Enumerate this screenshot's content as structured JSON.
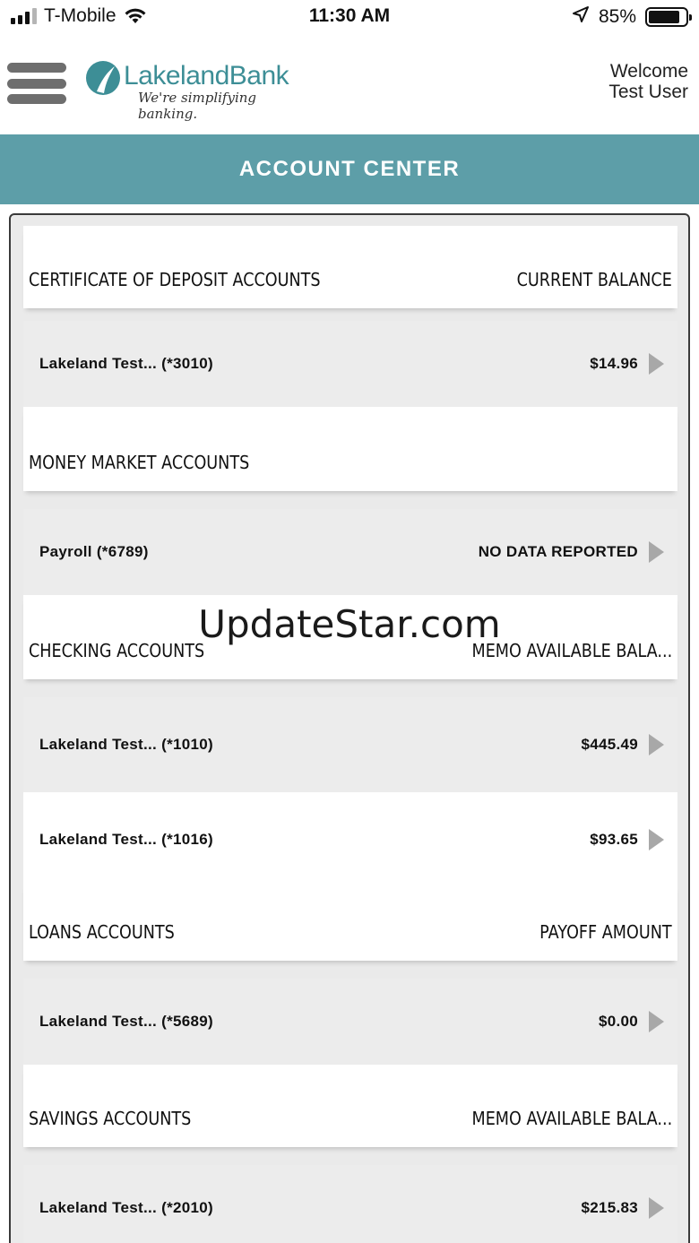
{
  "status_bar": {
    "carrier": "T-Mobile",
    "time": "11:30 AM",
    "battery_percent": "85%",
    "battery_level": 0.85
  },
  "header": {
    "logo_name": "LakelandBank",
    "logo_tagline": "We're simplifying banking.",
    "welcome_line1": "Welcome",
    "welcome_line2": "Test User"
  },
  "page_title": "ACCOUNT CENTER",
  "sections": [
    {
      "title": "CERTIFICATE OF DEPOSIT ACCOUNTS",
      "column": "CURRENT BALANCE",
      "rows": [
        {
          "name": "Lakeland Test...  (*3010)",
          "balance": "$14.96"
        }
      ]
    },
    {
      "title": "MONEY MARKET ACCOUNTS",
      "column": "",
      "rows": [
        {
          "name": "Payroll (*6789)",
          "balance": "NO DATA REPORTED"
        }
      ]
    },
    {
      "title": "CHECKING ACCOUNTS",
      "column": "MEMO AVAILABLE BALA...",
      "rows": [
        {
          "name": "Lakeland Test...  (*1010)",
          "balance": "$445.49"
        },
        {
          "name": "Lakeland Test...  (*1016)",
          "balance": "$93.65"
        }
      ]
    },
    {
      "title": "LOANS ACCOUNTS",
      "column": "PAYOFF AMOUNT",
      "rows": [
        {
          "name": "Lakeland Test...  (*5689)",
          "balance": "$0.00"
        }
      ]
    },
    {
      "title": "SAVINGS ACCOUNTS",
      "column": "MEMO AVAILABLE BALA...",
      "rows": [
        {
          "name": "Lakeland Test...  (*2010)",
          "balance": "$215.83"
        }
      ]
    }
  ],
  "watermark": "UpdateStar.com",
  "colors": {
    "accent": "#5d9ea8",
    "logo": "#3d8e96",
    "row_gray": "#ececec"
  }
}
